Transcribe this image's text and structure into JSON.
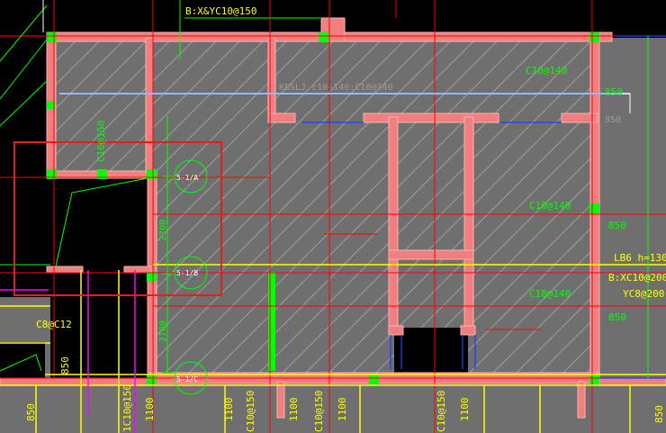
{
  "app": {
    "name": "CAD structural slab reinforcement drawing"
  },
  "labels": {
    "top_reinforcement": "B:X&YC10@150",
    "slab_span_note": "KBSLJ c10-140:C10@140",
    "rebar_top_right": "C10@140",
    "rebar_right_mid": "C10@140",
    "rebar_right_low": "C10@140",
    "dim_850_a": "850",
    "dim_850_b": "850",
    "dim_850_c": "850",
    "dim_850_d": "850",
    "left_rebar": "C10@150",
    "left_bottom_rebar": "C8@C12",
    "dim_850_left": "850",
    "beam_lb6": "LB6 h=130",
    "beam_bx": "B:XC10@200",
    "beam_yc": "YC8@200",
    "dim_2700_a": "2700",
    "dim_2700_b": "2700",
    "axis_1": "5-1/A",
    "axis_2": "5-1/B",
    "axis_3": "5-1/C",
    "bottom_1": "850",
    "bottom_2": "1C10@150",
    "bottom_3": "1100",
    "bottom_4": "1100",
    "bottom_5": "C10@150",
    "bottom_6": "1100",
    "bottom_7": "C10@150",
    "bottom_8": "1100",
    "bottom_9": "C10@150",
    "bottom_10": "1100",
    "bottom_11": "850"
  },
  "colors": {
    "background": "#000000",
    "slab_fill": "#6f6f6f",
    "wall_fill": "#f08080",
    "rebar_green": "#00ff00",
    "axis_red": "#ff0000",
    "line_yellow": "#ffff00",
    "selection_red": "#e02020",
    "blue_line": "#1e3cff",
    "magenta": "#ff00ff",
    "white": "#ffffff",
    "lightblue": "#9eb6ff"
  }
}
